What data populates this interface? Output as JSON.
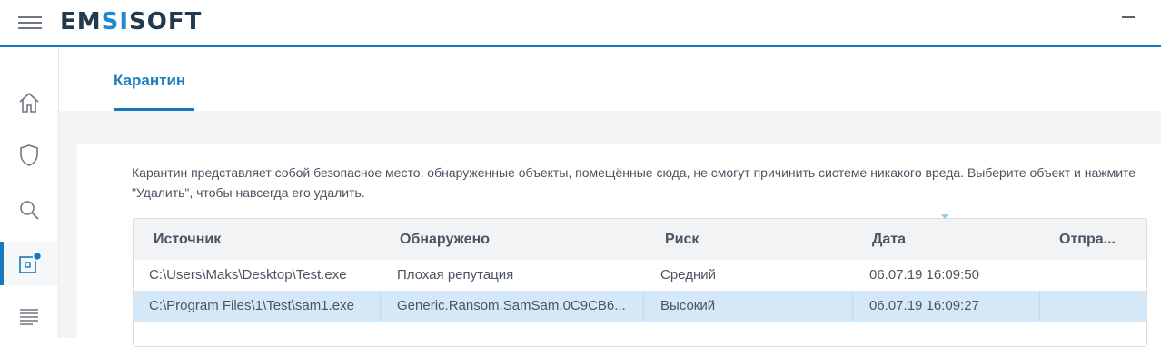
{
  "app": {
    "logo_left": "EM",
    "logo_mid": "SI",
    "logo_right": "SOFT"
  },
  "sidebar": {
    "items": [
      {
        "name": "home",
        "icon": "home-icon"
      },
      {
        "name": "protection",
        "icon": "shield-icon"
      },
      {
        "name": "scan",
        "icon": "search-icon"
      },
      {
        "name": "quarantine",
        "icon": "quarantine-icon",
        "active": true,
        "badge": true
      },
      {
        "name": "logs",
        "icon": "list-icon"
      }
    ]
  },
  "page": {
    "tab": "Карантин",
    "description": "Карантин представляет собой безопасное место: обнаруженные объекты, помещённые сюда, не смогут причинить системе никакого вреда. Выберите объект и нажмите \"Удалить\", чтобы навсегда его удалить."
  },
  "table": {
    "columns": [
      "Источник",
      "Обнаружено",
      "Риск",
      "Дата",
      "Отпра..."
    ],
    "rows": [
      [
        "C:\\Users\\Maks\\Desktop\\Test.exe",
        "Плохая репутация",
        "Средний",
        "06.07.19 16:09:50",
        ""
      ],
      [
        "C:\\Program Files\\1\\Test\\sam1.exe",
        "Generic.Ransom.SamSam.0C9CB6...",
        "Высокий",
        "06.07.19 16:09:27",
        ""
      ]
    ],
    "selected_row": 1
  },
  "colors": {
    "accent": "#1778be",
    "selection": "#d4e8f8",
    "text": "#4b5561"
  }
}
